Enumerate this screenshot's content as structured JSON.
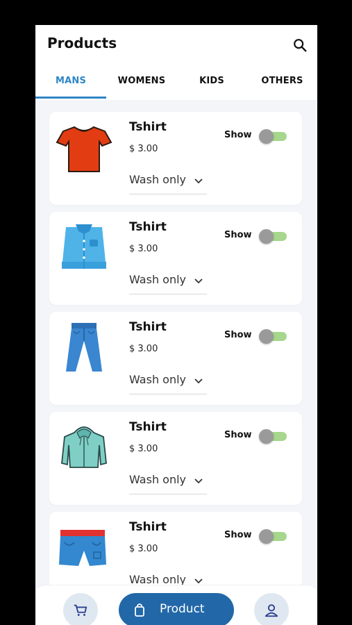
{
  "header": {
    "title": "Products"
  },
  "tabs": [
    {
      "label": "MANS"
    },
    {
      "label": "WOMENS"
    },
    {
      "label": "KIDS"
    },
    {
      "label": "OTHERS"
    }
  ],
  "products": [
    {
      "name": "Tshirt",
      "price": "$ 3.00",
      "option": "Wash only",
      "show_label": "Show",
      "image": "red-tshirt"
    },
    {
      "name": "Tshirt",
      "price": "$ 3.00",
      "option": "Wash only",
      "show_label": "Show",
      "image": "blue-shirt"
    },
    {
      "name": "Tshirt",
      "price": "$ 3.00",
      "option": "Wash only",
      "show_label": "Show",
      "image": "jeans"
    },
    {
      "name": "Tshirt",
      "price": "$ 3.00",
      "option": "Wash only",
      "show_label": "Show",
      "image": "jacket"
    },
    {
      "name": "Tshirt",
      "price": "$ 3.00",
      "option": "Wash only",
      "show_label": "Show",
      "image": "shorts"
    }
  ],
  "bottom_nav": {
    "product_label": "Product"
  },
  "colors": {
    "accent": "#2f86c6",
    "primary_button": "#2268a8",
    "toggle_track": "#a6d78c"
  },
  "icons": [
    "search-icon",
    "chevron-down-icon",
    "cart-icon",
    "shopping-bag-icon",
    "user-icon"
  ]
}
